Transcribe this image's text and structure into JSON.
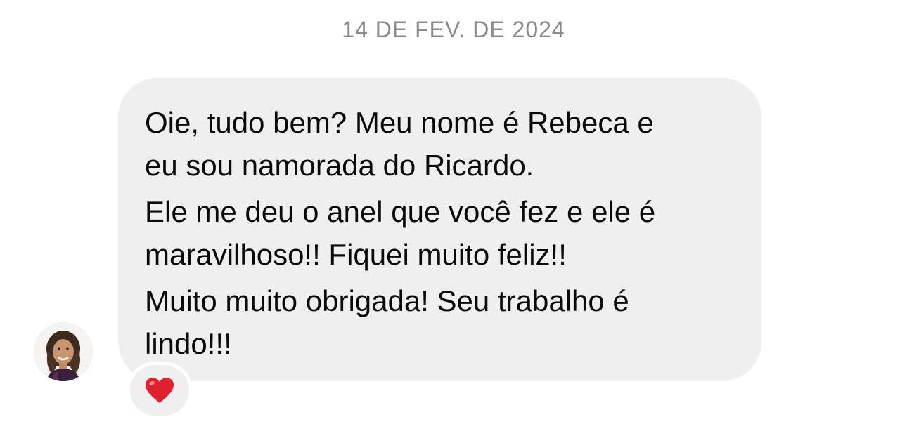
{
  "conversation": {
    "date_separator": "14 DE FEV. DE 2024",
    "message": {
      "paragraphs": [
        "Oie, tudo bem? Meu nome é Rebeca e\neu sou namorada do Ricardo.",
        "Ele me deu o anel que você fez e ele é\nmaravilhoso!! Fiquei muito feliz!!",
        "Muito muito obrigada! Seu trabalho é\nlindo!!!"
      ],
      "reaction": "heart-emoji",
      "sender_avatar": "avatar"
    }
  },
  "colors": {
    "bubble": "#efefef",
    "text": "#0a0a0a",
    "date": "#8a8a8e",
    "heart": "#e0202e"
  }
}
